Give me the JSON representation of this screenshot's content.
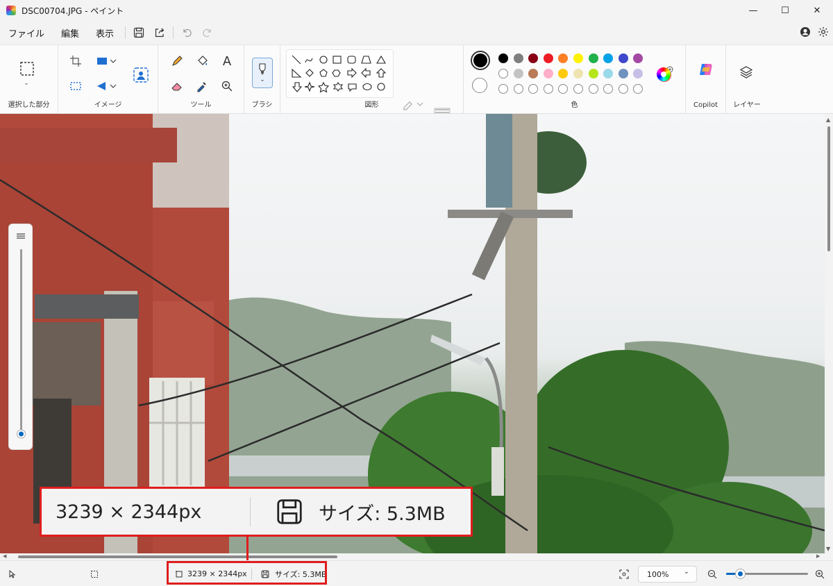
{
  "window": {
    "title": "DSC00704.JPG - ペイント",
    "minimize": "—",
    "maximize": "☐",
    "close": "✕"
  },
  "menu": {
    "file": "ファイル",
    "edit": "編集",
    "view": "表示"
  },
  "ribbon": {
    "selection_label": "選択した部分",
    "image_label": "イメージ",
    "tools_label": "ツール",
    "brush_label": "ブラシ",
    "shapes_label": "図形",
    "colors_label": "色",
    "copilot_label": "Copilot",
    "layers_label": "レイヤー",
    "text_tool_glyph": "A"
  },
  "palette": {
    "primary": "#000000",
    "secondary": "#ffffff",
    "row1": [
      "#000000",
      "#7f7f7f",
      "#880015",
      "#ed1c24",
      "#ff7f27",
      "#fff200",
      "#22b14c",
      "#00a2e8",
      "#3f48cc",
      "#a349a4"
    ],
    "row2": [
      "#ffffff",
      "#c3c3c3",
      "#b97a57",
      "#ffaec9",
      "#ffc90e",
      "#efe4b0",
      "#b5e61d",
      "#99d9ea",
      "#7092be",
      "#c8bfe7"
    ]
  },
  "callout": {
    "dimensions": "3239 × 2344px",
    "file_size": "サイズ: 5.3MB"
  },
  "status": {
    "dimensions": "3239 × 2344px",
    "file_size": "サイズ: 5.3MB",
    "zoom": "100%",
    "zoom_level": 0.17
  },
  "colors": {
    "highlight": "#e01d1d",
    "accent": "#0067c0"
  }
}
